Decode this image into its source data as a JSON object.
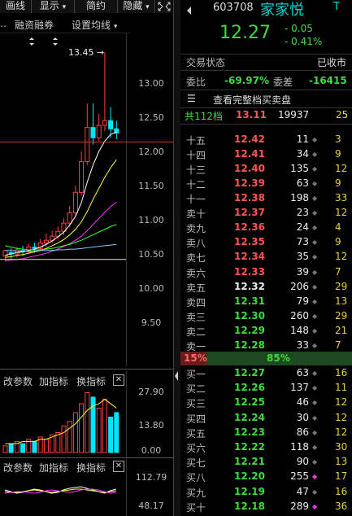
{
  "toolbar": {
    "items": [
      "画线",
      "显示",
      "简约",
      "隐藏"
    ],
    "show_arrow": "▾",
    "hide_arrow": "▾"
  },
  "chart_toolbar": {
    "margin_trading": "融资融券",
    "ma_settings": "设置均线",
    "ma_arrow": "▾"
  },
  "stock": {
    "code": "603708",
    "name": "家家悦",
    "tag": "T",
    "price": "12.27",
    "change": "- 0.05",
    "change_pct": "- 0.41%"
  },
  "status": {
    "label": "交易状态",
    "value": "已收市"
  },
  "ratio": {
    "label": "委比",
    "value": "-69.97%",
    "diff_label": "委差",
    "diff_value": "-16415"
  },
  "full_book_button": "查看完整档买卖盘",
  "total_levels": {
    "label": "共112档",
    "price": "13.11",
    "volume": "19937",
    "extra": "25"
  },
  "sell_levels": [
    {
      "label": "十五",
      "price": "12.42",
      "vol": "11",
      "extra": "3"
    },
    {
      "label": "十四",
      "price": "12.41",
      "vol": "34",
      "extra": "9"
    },
    {
      "label": "十三",
      "price": "12.40",
      "vol": "135",
      "extra": "12"
    },
    {
      "label": "十二",
      "price": "12.39",
      "vol": "63",
      "extra": "9"
    },
    {
      "label": "十一",
      "price": "12.38",
      "vol": "198",
      "extra": "33"
    },
    {
      "label": "卖十",
      "price": "12.37",
      "vol": "23",
      "extra": "12"
    },
    {
      "label": "卖九",
      "price": "12.36",
      "vol": "24",
      "extra": "4"
    },
    {
      "label": "卖八",
      "price": "12.35",
      "vol": "73",
      "extra": "9"
    },
    {
      "label": "卖七",
      "price": "12.34",
      "vol": "35",
      "extra": "12"
    },
    {
      "label": "卖六",
      "price": "12.33",
      "vol": "39",
      "extra": "7"
    },
    {
      "label": "卖五",
      "price": "12.32",
      "vol": "206",
      "extra": "29"
    },
    {
      "label": "卖四",
      "price": "12.31",
      "vol": "79",
      "extra": "13"
    },
    {
      "label": "卖三",
      "price": "12.30",
      "vol": "260",
      "extra": "29"
    },
    {
      "label": "卖二",
      "price": "12.29",
      "vol": "148",
      "extra": "21"
    },
    {
      "label": "卖一",
      "price": "12.28",
      "vol": "33",
      "extra": "7"
    }
  ],
  "sell_price_colors": [
    "red",
    "red",
    "red",
    "red",
    "red",
    "red",
    "red",
    "red",
    "red",
    "red",
    "white",
    "green",
    "green",
    "green",
    "green"
  ],
  "balance": {
    "buy_pct": "15%",
    "sell_pct": "85%"
  },
  "buy_levels": [
    {
      "label": "买一",
      "price": "12.27",
      "vol": "63",
      "extra": "16"
    },
    {
      "label": "买二",
      "price": "12.26",
      "vol": "137",
      "extra": "11"
    },
    {
      "label": "买三",
      "price": "12.25",
      "vol": "46",
      "extra": "12"
    },
    {
      "label": "买四",
      "price": "12.24",
      "vol": "30",
      "extra": "12"
    },
    {
      "label": "买五",
      "price": "12.23",
      "vol": "86",
      "extra": "12"
    },
    {
      "label": "买六",
      "price": "12.22",
      "vol": "118",
      "extra": "30"
    },
    {
      "label": "买七",
      "price": "12.21",
      "vol": "90",
      "extra": "13"
    },
    {
      "label": "买八",
      "price": "12.20",
      "vol": "255",
      "extra": "17"
    },
    {
      "label": "买九",
      "price": "12.19",
      "vol": "47",
      "extra": "16"
    },
    {
      "label": "买十",
      "price": "12.18",
      "vol": "289",
      "extra": "36"
    }
  ],
  "price_axis": [
    "13.00",
    "12.50",
    "12.00",
    "11.50",
    "11.00",
    "10.50",
    "10.00",
    "9.50"
  ],
  "high_label": "13.45",
  "panel1": {
    "modify_params": "改参数",
    "add_indicator": "加指标",
    "change_indicator": "换指标",
    "axis": [
      "27.90",
      "13.80",
      "0.00"
    ]
  },
  "panel2": {
    "modify_params": "改参数",
    "add_indicator": "加指标",
    "change_indicator": "换指标",
    "axis": [
      "112.79",
      "48.17"
    ]
  },
  "colors": {
    "up": "#ff4040",
    "down": "#00e5ff",
    "ma5": "#ffffff",
    "ma10": "#ffff33",
    "ma20": "#ff33ff",
    "ma60": "#33ff33",
    "brand": "#00d0d0"
  }
}
